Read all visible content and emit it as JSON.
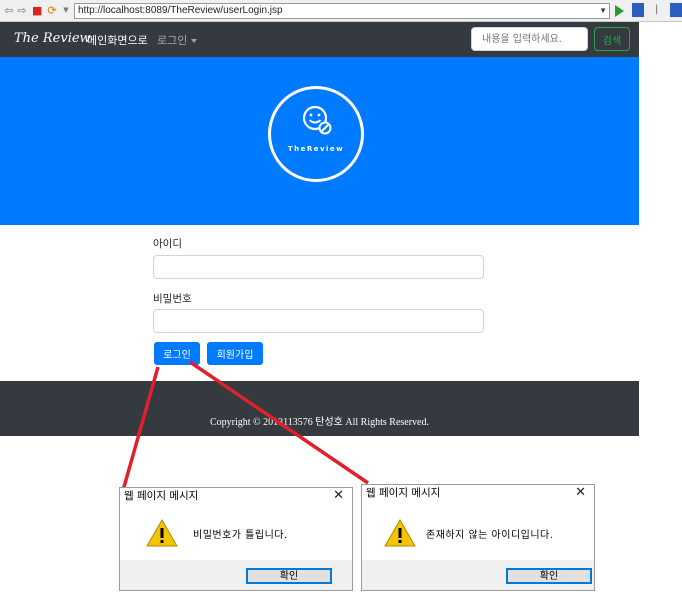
{
  "browser": {
    "url": "http://localhost:8089/TheReview/userLogin.jsp"
  },
  "navbar": {
    "brand": "The Review",
    "main_link": "메인화면으로",
    "login_menu": "로그인",
    "search_placeholder": "내용을 입력하세요.",
    "search_button": "검색"
  },
  "hero": {
    "logo_text": "TheReview"
  },
  "form": {
    "id_label": "아이디",
    "password_label": "비밀번호",
    "login_button": "로그인",
    "signup_button": "회원가입"
  },
  "footer": {
    "copyright": "Copyright © 2013113576 탄성호 All Rights Reserved."
  },
  "dialogs": [
    {
      "title": "웹 페이지 메시지",
      "message": "비밀번호가 틀립니다.",
      "ok_button": "확인"
    },
    {
      "title": "웹 페이지 메시지",
      "message": "존재하지 않는 아이디입니다.",
      "ok_button": "확인"
    }
  ],
  "colors": {
    "navbar": "#343a40",
    "hero": "#007bff",
    "primary": "#007bff",
    "success": "#28a745",
    "arrow": "#e0202a",
    "warning": "#f5c400"
  }
}
